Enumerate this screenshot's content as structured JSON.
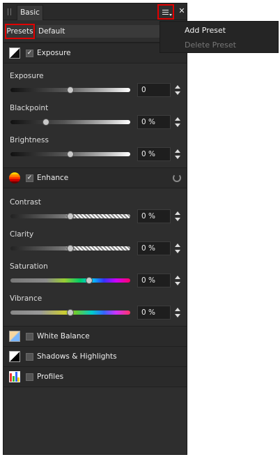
{
  "titlebar": {
    "tab_label": "Basic"
  },
  "presets": {
    "button_label": "Presets",
    "selected": "Default"
  },
  "menu": {
    "items": [
      {
        "label": "Add Preset",
        "enabled": true
      },
      {
        "label": "Delete Preset",
        "enabled": false
      }
    ]
  },
  "sections": {
    "exposure": {
      "label": "Exposure",
      "checked": true,
      "rows": [
        {
          "label": "Exposure",
          "value": "0",
          "level": 0.5
        },
        {
          "label": "Blackpoint",
          "value": "0 %",
          "level": 0.3
        },
        {
          "label": "Brightness",
          "value": "0 %",
          "level": 0.5
        }
      ]
    },
    "enhance": {
      "label": "Enhance",
      "checked": true,
      "rows": [
        {
          "label": "Contrast",
          "value": "0 %",
          "level": 0.5
        },
        {
          "label": "Clarity",
          "value": "0 %",
          "level": 0.5
        },
        {
          "label": "Saturation",
          "value": "0 %",
          "level": 0.67
        },
        {
          "label": "Vibrance",
          "value": "0 %",
          "level": 0.5
        }
      ]
    },
    "white_balance": {
      "label": "White Balance",
      "checked": false
    },
    "shadows_highlights": {
      "label": "Shadows & Highlights",
      "checked": false
    },
    "profiles": {
      "label": "Profiles",
      "checked": false
    }
  },
  "colors": {
    "highlight_outline": "#e00000",
    "panel_bg": "#2e2e2e"
  }
}
